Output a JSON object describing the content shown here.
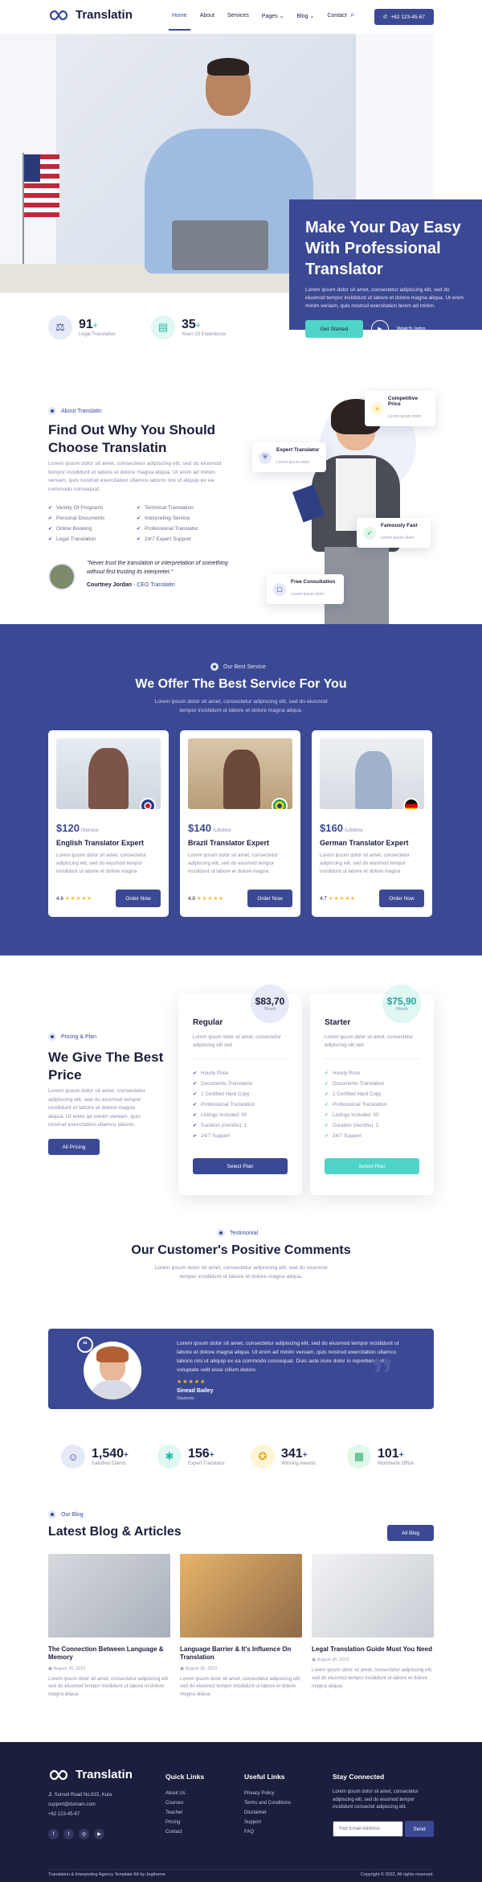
{
  "header": {
    "logo": "Translatin",
    "nav": [
      "Home",
      "About",
      "Services",
      "Pages",
      "Blog",
      "Contact"
    ],
    "phone": "+62 123-45-67"
  },
  "hero": {
    "title_line1": "Make Your Day Easy",
    "title_line2": "With Professional",
    "title_line3": "Translator",
    "desc": "Lorem ipsum dolor sit amet, consectetur adipiscing elit, sed do eiusmod tempor incididunt ut labore et dolore magna aliqua. Ut enim minim veniam, quis nostrud exercitation tenim ad minim.",
    "cta": "Get Started",
    "watch": "Watch Intro",
    "stats": [
      {
        "num": "91",
        "suffix": "+",
        "label": "Legal Translation"
      },
      {
        "num": "35",
        "suffix": "+",
        "label": "Years Of Experience"
      }
    ]
  },
  "about": {
    "tag": "About Translatin",
    "title_line1": "Find Out Why You Should",
    "title_line2": "Choose Translatin",
    "desc": "Lorem ipsum dolor sit amet, consectetur adipiscing elit, sed do eiusmod tempor incididunt ut labore et dolore magna aliqua. Ut enim ad minim veniam, quis nostrud exercitation ullamco laboris nisi ut aliquip ex ea commodo consequat.",
    "list": [
      "Variety Of Programs",
      "Technical Translation",
      "Personal Documents",
      "Interpreting Service",
      "Online Booking",
      "Professional Translator",
      "Legal Translation",
      "24/7 Expert Support"
    ],
    "quote": "\"Never trust the translation or interpretation of something without first trusting its interpreter.\"",
    "author": "Courtney Jordan",
    "role": "- CEO Translatin",
    "cards": [
      {
        "title": "Competitive Price",
        "sub": "Lorem ipsum dolor"
      },
      {
        "title": "Expert Translator",
        "sub": "Lorem ipsum dolor"
      },
      {
        "title": "Famously Fast",
        "sub": "Lorem ipsum dolor"
      },
      {
        "title": "Free Consultation",
        "sub": "Lorem ipsum dolor"
      }
    ]
  },
  "services": {
    "tag": "Our Best Service",
    "title": "We Offer The Best Service For You",
    "desc_line1": "Lorem ipsum dolor sit amet, consectetur adipiscing elit, sed do eiusmod",
    "desc_line2": "tempor incididunt ut labore et dolore magna aliqua.",
    "cards": [
      {
        "price": "$120",
        "per": "/Service",
        "title": "English Translator Expert",
        "desc": "Lorem ipsum dolor sit amet, consectetur adipiscing elit, sed do eiusmod tempor incididunt ut labore et dolore magna",
        "rating": "4.6",
        "btn": "Order Now"
      },
      {
        "price": "$140",
        "per": "/Lifetime",
        "title": "Brazil Translator Expert",
        "desc": "Lorem ipsum dolor sit amet, consectetur adipiscing elit, sed do eiusmod tempor incididunt ut labore et dolore magna",
        "rating": "4.8",
        "btn": "Order Now"
      },
      {
        "price": "$160",
        "per": "/Lifetime",
        "title": "German Translator Expert",
        "desc": "Lorem ipsum dolor sit amet, consectetur adipiscing elit, sed do eiusmod tempor incididunt ut labore et dolore magna",
        "rating": "4.7",
        "btn": "Order Now"
      }
    ]
  },
  "pricing": {
    "tag": "Pricing & Plan",
    "title_line1": "We Give The Best",
    "title_line2": "Price",
    "desc": "Lorem ipsum dolor sit amet, consectetur adipiscing elit, sed do eiusmod tempor incididunt ut labore et dolore magna aliqua. Ut enim ad minim veniam, quis nostrud exercitation ullamco laboris.",
    "btn": "All Pricing",
    "plans": [
      {
        "name": "Regular",
        "price": "$83,70",
        "per": "/Month",
        "desc": "Lorem ipsum dolor sit amet, consectetur adipiscing elit sed",
        "features": [
          "Hourly Price",
          "Documents Translation",
          "1 Certified Hard Copy",
          "Professional Translation",
          "Listings Included: 50",
          "Duration (months): 1",
          "24/7 Support"
        ],
        "btn": "Select Plan"
      },
      {
        "name": "Starter",
        "price": "$75,90",
        "per": "/Month",
        "desc": "Lorem ipsum dolor sit amet, consectetur adipiscing elit sed",
        "features": [
          "Hourly Price",
          "Documents Translation",
          "1 Certified Hard Copy",
          "Professional Translation",
          "Listings Included: 50",
          "Duration (months): 1",
          "24/7 Support"
        ],
        "btn": "Select Plan"
      }
    ]
  },
  "testimonial": {
    "tag": "Testimonial",
    "title": "Our Customer's Positive Comments",
    "desc_line1": "Lorem ipsum dolor sit amet, consectetur adipiscing elit, sed do eiusmod",
    "desc_line2": "tempor incididunt ut labore et dolore magna aliqua.",
    "text": "Lorem ipsum dolor sit amet, consectetur adipiscing elit, sed do eiusmod tempor incididunt ut labore et dolore magna aliqua. Ut enim ad minim veniam, quis nostrud exercitation ullamco laboris nisi ut aliquip ex ea commodo consequat. Duis aute irure dolor in reprehenderit in voluptate velit esse cillum dolore.",
    "name": "Sinead Bailey",
    "role": "Students",
    "stars": "★★★★★"
  },
  "counters": [
    {
      "num": "1,540",
      "suffix": "+",
      "label": "Satisfied Clients"
    },
    {
      "num": "156",
      "suffix": "+",
      "label": "Expert Translator"
    },
    {
      "num": "341",
      "suffix": "+",
      "label": "Winning Awards"
    },
    {
      "num": "101",
      "suffix": "+",
      "label": "Worldwide Office"
    }
  ],
  "blog": {
    "tag": "Our Blog",
    "title": "Latest Blog & Articles",
    "btn": "All Blog",
    "posts": [
      {
        "title": "The Connection Between Language & Memory",
        "date": "August 26, 2022",
        "desc": "Lorem ipsum dolor sit amet, consectetur adipiscing elit, sed do eiusmod tempor incididunt ut labore et dolore magna aliqua."
      },
      {
        "title": "Language Barrier & It's Influence On Translation",
        "date": "August 26, 2022",
        "desc": "Lorem ipsum dolor sit amet, consectetur adipiscing elit, sed do eiusmod tempor incididunt ut labore et dolore magna aliqua."
      },
      {
        "title": "Legal Translation Guide Must You Need",
        "date": "August 26, 2022",
        "desc": "Lorem ipsum dolor sit amet, consectetur adipiscing elit, sed do eiusmod tempor incididunt ut labore et dolore magna aliqua."
      }
    ]
  },
  "footer": {
    "logo": "Translatin",
    "address": "Jl. Sunset Road No.815, Kuta",
    "email": "support@domain.com",
    "phone": "+62 123-45-67",
    "quick_title": "Quick Links",
    "quick": [
      "About Us",
      "Courses",
      "Teacher",
      "Pricing",
      "Contact"
    ],
    "useful_title": "Useful Links",
    "useful": [
      "Privacy Policy",
      "Terms and Conditions",
      "Disclaimer",
      "Support",
      "FAQ"
    ],
    "stay_title": "Stay Connected",
    "stay_desc": "Lorem ipsum dolor sit amet, consectetur adipiscing elit, sed do eiusmod tempor incididunt consectet adipiscing elit.",
    "email_placeholder": "Your Email Address",
    "send": "Send",
    "bottom_left": "Translation & Interpreting Agency Template Kit by Jegtheme",
    "bottom_right": "Copyright © 2022, All rights reserved."
  },
  "colors": {
    "primary": "#3b4994",
    "navy": "#1b1e3c",
    "teal": "#4fd4c8",
    "star": "#f5b72a"
  }
}
